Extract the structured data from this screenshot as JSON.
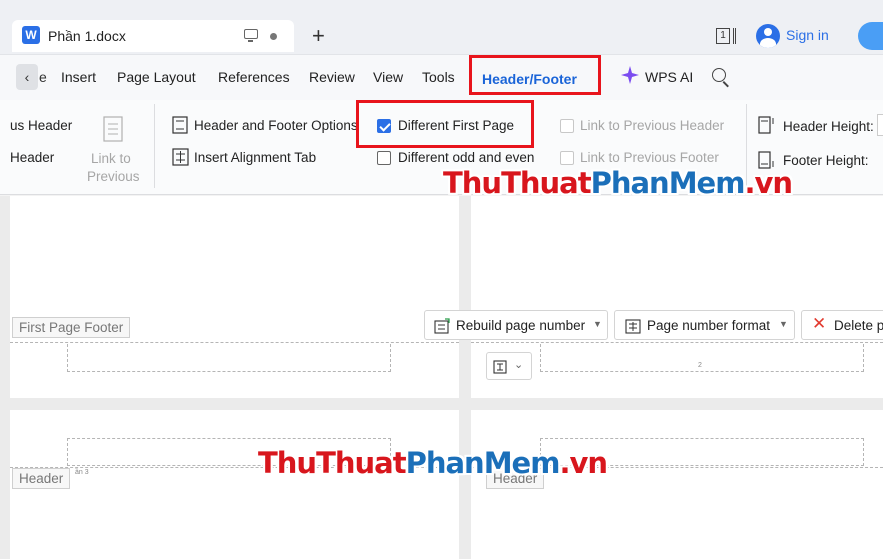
{
  "titlebar": {
    "app_icon_letter": "W",
    "doc_tab_title": "Phần 1.docx",
    "layout_badge": "1",
    "signin_label": "Sign in"
  },
  "ribbon_tabs": {
    "back_fragment": "e",
    "insert": "Insert",
    "page_layout": "Page Layout",
    "references": "References",
    "review": "Review",
    "view": "View",
    "tools": "Tools",
    "header_footer": "Header/Footer",
    "wps_ai": "WPS AI"
  },
  "toolbar": {
    "prev_header_partial": "us Header",
    "header_partial": "Header",
    "link_to_previous_line1": "Link to",
    "link_to_previous_line2": "Previous",
    "header_footer_options": "Header and Footer Options",
    "insert_alignment_tab": "Insert Alignment Tab",
    "different_first_page": "Different First Page",
    "different_odd_even": "Different odd and even",
    "link_prev_header": "Link to Previous Header",
    "link_prev_footer": "Link to Previous Footer",
    "header_height": "Header Height:",
    "footer_height": "Footer Height:"
  },
  "document": {
    "first_page_footer_label": "First Page Footer",
    "rebuild_page_number": "Rebuild page number",
    "page_number_format": "Page number format",
    "delete_partial": "Delete p",
    "footer_page_digit": "2",
    "header_label_left": "Header",
    "header_label_right": "Header",
    "section_tag": "ần 3"
  },
  "watermark": {
    "part1": "ThuThuat",
    "part2": "PhanMem",
    "part3": ".vn"
  },
  "colors": {
    "highlight_red": "#e8141c",
    "active_tab_blue": "#1a64d8",
    "brand_blue": "#2b6fe6"
  }
}
